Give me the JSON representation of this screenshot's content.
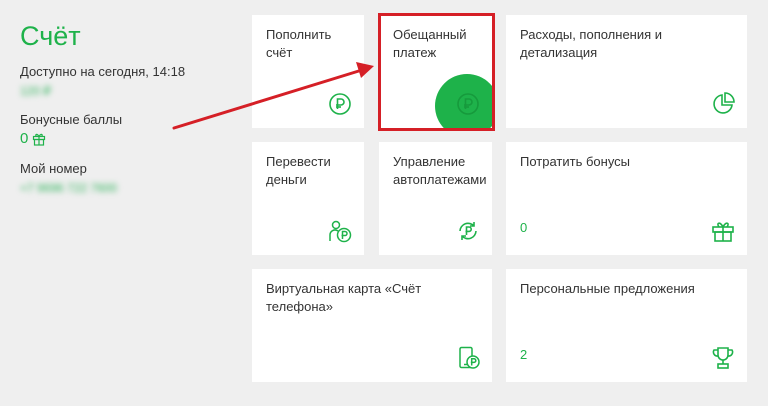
{
  "account": {
    "title": "Счёт",
    "available_label": "Доступно на сегодня, 14:18",
    "available_value": "120 ₽",
    "bonus_label": "Бонусные баллы",
    "bonus_value": "0",
    "number_label": "Мой номер",
    "number_value": "+7 9696 722 7600"
  },
  "tiles": {
    "top_up": {
      "title": "Пополнить счёт",
      "icon": "ruble-circle-icon"
    },
    "promised_payment": {
      "title": "Обещанный платеж",
      "icon": "ruble-circle-icon"
    },
    "expenses": {
      "title": "Расходы, пополнения и детализация",
      "icon": "pie-chart-icon"
    },
    "transfer": {
      "title": "Перевести деньги",
      "icon": "person-ruble-icon"
    },
    "autopay": {
      "title": "Управление автоплатежами",
      "icon": "autopay-cycle-icon"
    },
    "spend_bonuses": {
      "title": "Потратить бонусы",
      "count": "0",
      "icon": "gift-icon"
    },
    "virtual_card": {
      "title": "Виртуальная карта «Счёт телефона»",
      "icon": "phone-ruble-icon"
    },
    "offers": {
      "title": "Персональные предложения",
      "count": "2",
      "icon": "trophy-icon"
    }
  },
  "colors": {
    "accent": "#1eb24a",
    "highlight": "#d51f26",
    "background": "#efefef",
    "tile": "#ffffff"
  }
}
